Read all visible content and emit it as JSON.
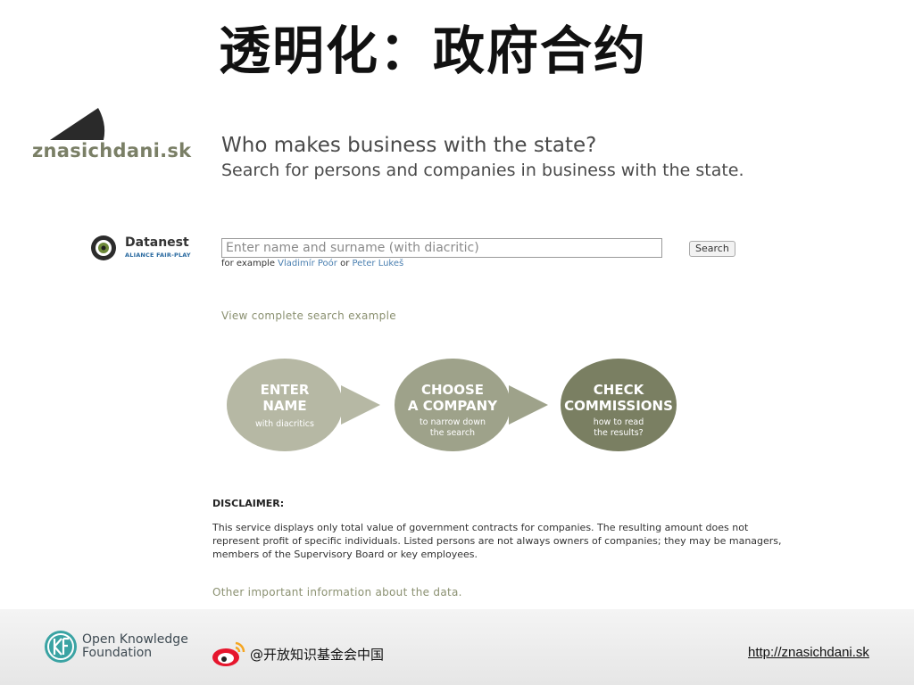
{
  "slide": {
    "title": "透明化：政府合约"
  },
  "site": {
    "logo_text": "znasichdani.sk",
    "headline": "Who makes business with the state?",
    "subheadline": "Search for persons and companies in business with the state."
  },
  "partner": {
    "name": "Datanest",
    "tagline": "ALIANCE FAIR-PLAY"
  },
  "search": {
    "placeholder": "Enter name and surname (with diacritic)",
    "button_label": "Search",
    "example_prefix": "for example",
    "example_1": "Vladimír Poór",
    "example_or": "or",
    "example_2": "Peter Lukeš"
  },
  "links": {
    "complete_example": "View complete search example",
    "other_info": "Other important information about the data."
  },
  "steps": [
    {
      "line1": "ENTER",
      "line2": "NAME",
      "sub1": "with diacritics",
      "sub2": "",
      "color": "#b6b8a4"
    },
    {
      "line1": "CHOOSE",
      "line2": "A COMPANY",
      "sub1": "to narrow down",
      "sub2": "the search",
      "color": "#9ea28a"
    },
    {
      "line1": "CHECK",
      "line2": "COMMISSIONS",
      "sub1": "how to read",
      "sub2": "the results?",
      "color": "#7a7f62"
    }
  ],
  "disclaimer": {
    "title": "DISCLAIMER:",
    "text": "This service displays only total value of government contracts for companies. The resulting amount does not represent profit of specific individuals. Listed persons are not always owners of companies; they may be managers, members of the Supervisory Board or key employees."
  },
  "footer": {
    "okf_line1": "Open Knowledge",
    "okf_line2": "Foundation",
    "weibo_handle": "@开放知识基金会中国",
    "url": "http://znasichdani.sk"
  },
  "colors": {
    "logo_green": "#7a7f66",
    "link_green": "#8a9070",
    "link_blue": "#4a7fb0"
  }
}
